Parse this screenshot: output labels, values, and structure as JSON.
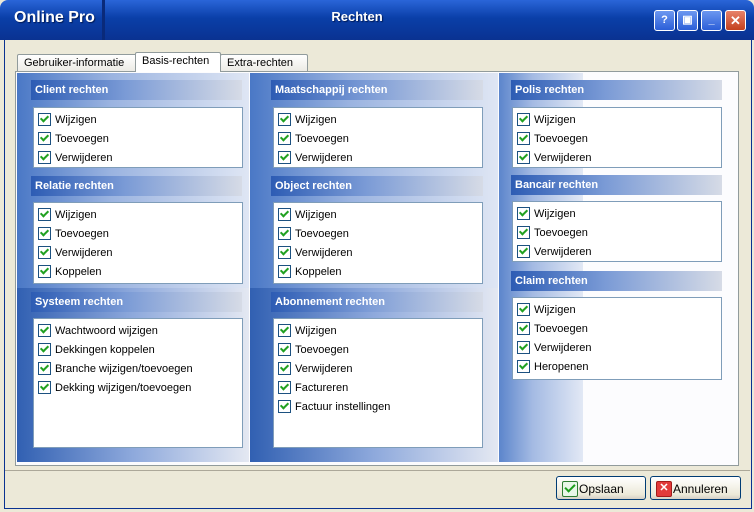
{
  "window": {
    "app_name": "Online Pro",
    "title": "Rechten",
    "help_label": "?",
    "restore_label": "▣",
    "minimize_label": "_",
    "close_label": "✕"
  },
  "tabs": [
    {
      "label": "Gebruiker-informatie"
    },
    {
      "label": "Basis-rechten"
    },
    {
      "label": "Extra-rechten"
    }
  ],
  "sections": {
    "client": {
      "title": "Client rechten",
      "items": [
        "Wijzigen",
        "Toevoegen",
        "Verwijderen"
      ]
    },
    "relatie": {
      "title": "Relatie rechten",
      "items": [
        "Wijzigen",
        "Toevoegen",
        "Verwijderen",
        "Koppelen"
      ]
    },
    "systeem": {
      "title": "Systeem rechten",
      "items": [
        "Wachtwoord wijzigen",
        "Dekkingen koppelen",
        "Branche wijzigen/toevoegen",
        "Dekking wijzigen/toevoegen"
      ]
    },
    "maatschappij": {
      "title": "Maatschappij rechten",
      "items": [
        "Wijzigen",
        "Toevoegen",
        "Verwijderen"
      ]
    },
    "object": {
      "title": "Object rechten",
      "items": [
        "Wijzigen",
        "Toevoegen",
        "Verwijderen",
        "Koppelen"
      ]
    },
    "abonnement": {
      "title": "Abonnement rechten",
      "items": [
        "Wijzigen",
        "Toevoegen",
        "Verwijderen",
        "Factureren",
        "Factuur instellingen"
      ]
    },
    "polis": {
      "title": "Polis rechten",
      "items": [
        "Wijzigen",
        "Toevoegen",
        "Verwijderen"
      ]
    },
    "bancair": {
      "title": "Bancair rechten",
      "items": [
        "Wijzigen",
        "Toevoegen",
        "Verwijderen"
      ]
    },
    "claim": {
      "title": "Claim rechten",
      "items": [
        "Wijzigen",
        "Toevoegen",
        "Verwijderen",
        "Heropenen"
      ]
    }
  },
  "buttons": {
    "save_label": "Opslaan",
    "cancel_label": "Annuleren"
  },
  "colors": {
    "title_bar": "#0a3fa8",
    "section_header": "#2d5cb4",
    "checkmark": "#21a121"
  }
}
